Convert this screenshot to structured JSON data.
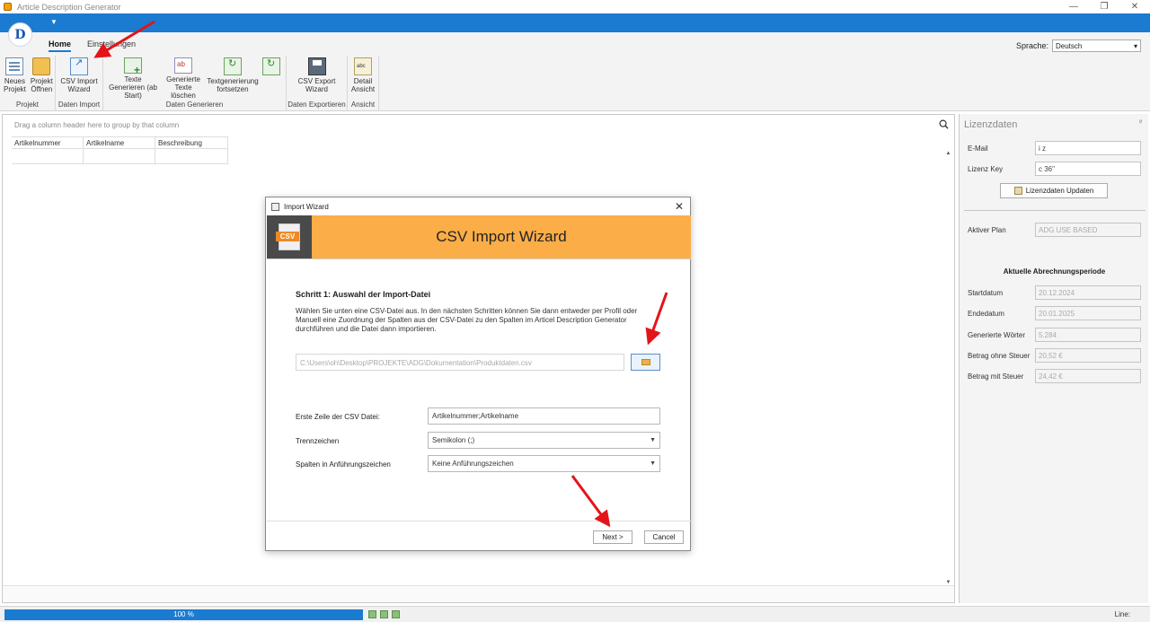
{
  "app": {
    "title": "Article Description Generator"
  },
  "window_controls": {
    "minimize": "—",
    "restore": "❐",
    "close": "✕"
  },
  "ribbon": {
    "logo": "D",
    "tabs": [
      {
        "label": "Home"
      },
      {
        "label": "Einstellungen"
      }
    ],
    "sprache_label": "Sprache:",
    "sprache_value": "Deutsch",
    "groups": {
      "projekt": {
        "label": "Projekt",
        "buttons": [
          "Neues Projekt",
          "Projekt Öffnen"
        ]
      },
      "daten_import": {
        "label": "Daten Import",
        "buttons": [
          "CSV Import Wizard"
        ]
      },
      "daten_generieren": {
        "label": "Daten Generieren",
        "buttons": [
          "Texte Generieren (ab Start)",
          "Generierte Texte löschen",
          "Textgenerierung fortsetzen",
          ""
        ]
      },
      "daten_exportieren": {
        "label": "Daten Exportieren",
        "buttons": [
          "CSV Export Wizard"
        ]
      },
      "ansicht": {
        "label": "Ansicht",
        "buttons": [
          "Detail Ansicht"
        ]
      }
    }
  },
  "grid": {
    "group_hint": "Drag a column header here to group by that column",
    "columns": [
      "Artikelnummer",
      "Artikelname",
      "Beschreibung"
    ]
  },
  "lizenz": {
    "title": "Lizenzdaten",
    "pin": "ᵖ",
    "email_label": "E-Mail",
    "email_value": "i          z",
    "key_label": "Lizenz Key",
    "key_value": "c       36\"",
    "update_button": "Lizenzdaten Updaten",
    "plan_label": "Aktiver Plan",
    "plan_value": "ADG USE BASED",
    "period_heading": "Aktuelle Abrechnungsperiode",
    "fields": [
      {
        "label": "Startdatum",
        "value": "20.12.2024"
      },
      {
        "label": "Endedatum",
        "value": "20.01.2025"
      },
      {
        "label": "Generierte Wörter",
        "value": "5.284"
      },
      {
        "label": "Betrag ohne Steuer",
        "value": "20,52 €"
      },
      {
        "label": "Betrag mit Steuer",
        "value": "24,42 €"
      }
    ]
  },
  "status": {
    "progress_label": "100 %",
    "progress_fraction": 1.0,
    "line_label": "Line:"
  },
  "dialog": {
    "title": "Import Wizard",
    "banner_title": "CSV Import Wizard",
    "banner_icon_text": "CSV",
    "step_title": "Schritt 1: Auswahl der Import-Datei",
    "step_description": "Wählen Sie unten eine CSV-Datei aus. In den nächsten Schritten können Sie dann entweder per Profil oder Manuell eine Zuordnung der Spalten aus der CSV-Datei zu den Spalten im Articel Description Generator durchführen und die Datei dann importieren.",
    "file_path": "C:\\Users\\oh\\Desktop\\PROJEKTE\\ADG\\Dokumentation\\Produktdaten.csv",
    "first_line_label": "Erste Zeile der CSV Datei:",
    "first_line_value": "Artikelnummer;Artikelname",
    "separator_label": "Trennzeichen",
    "separator_value": "Semikolon (;)",
    "quotes_label": "Spalten in Anführungszeichen",
    "quotes_value": "Keine Anführungszeichen",
    "next_button": "Next >",
    "cancel_button": "Cancel"
  }
}
